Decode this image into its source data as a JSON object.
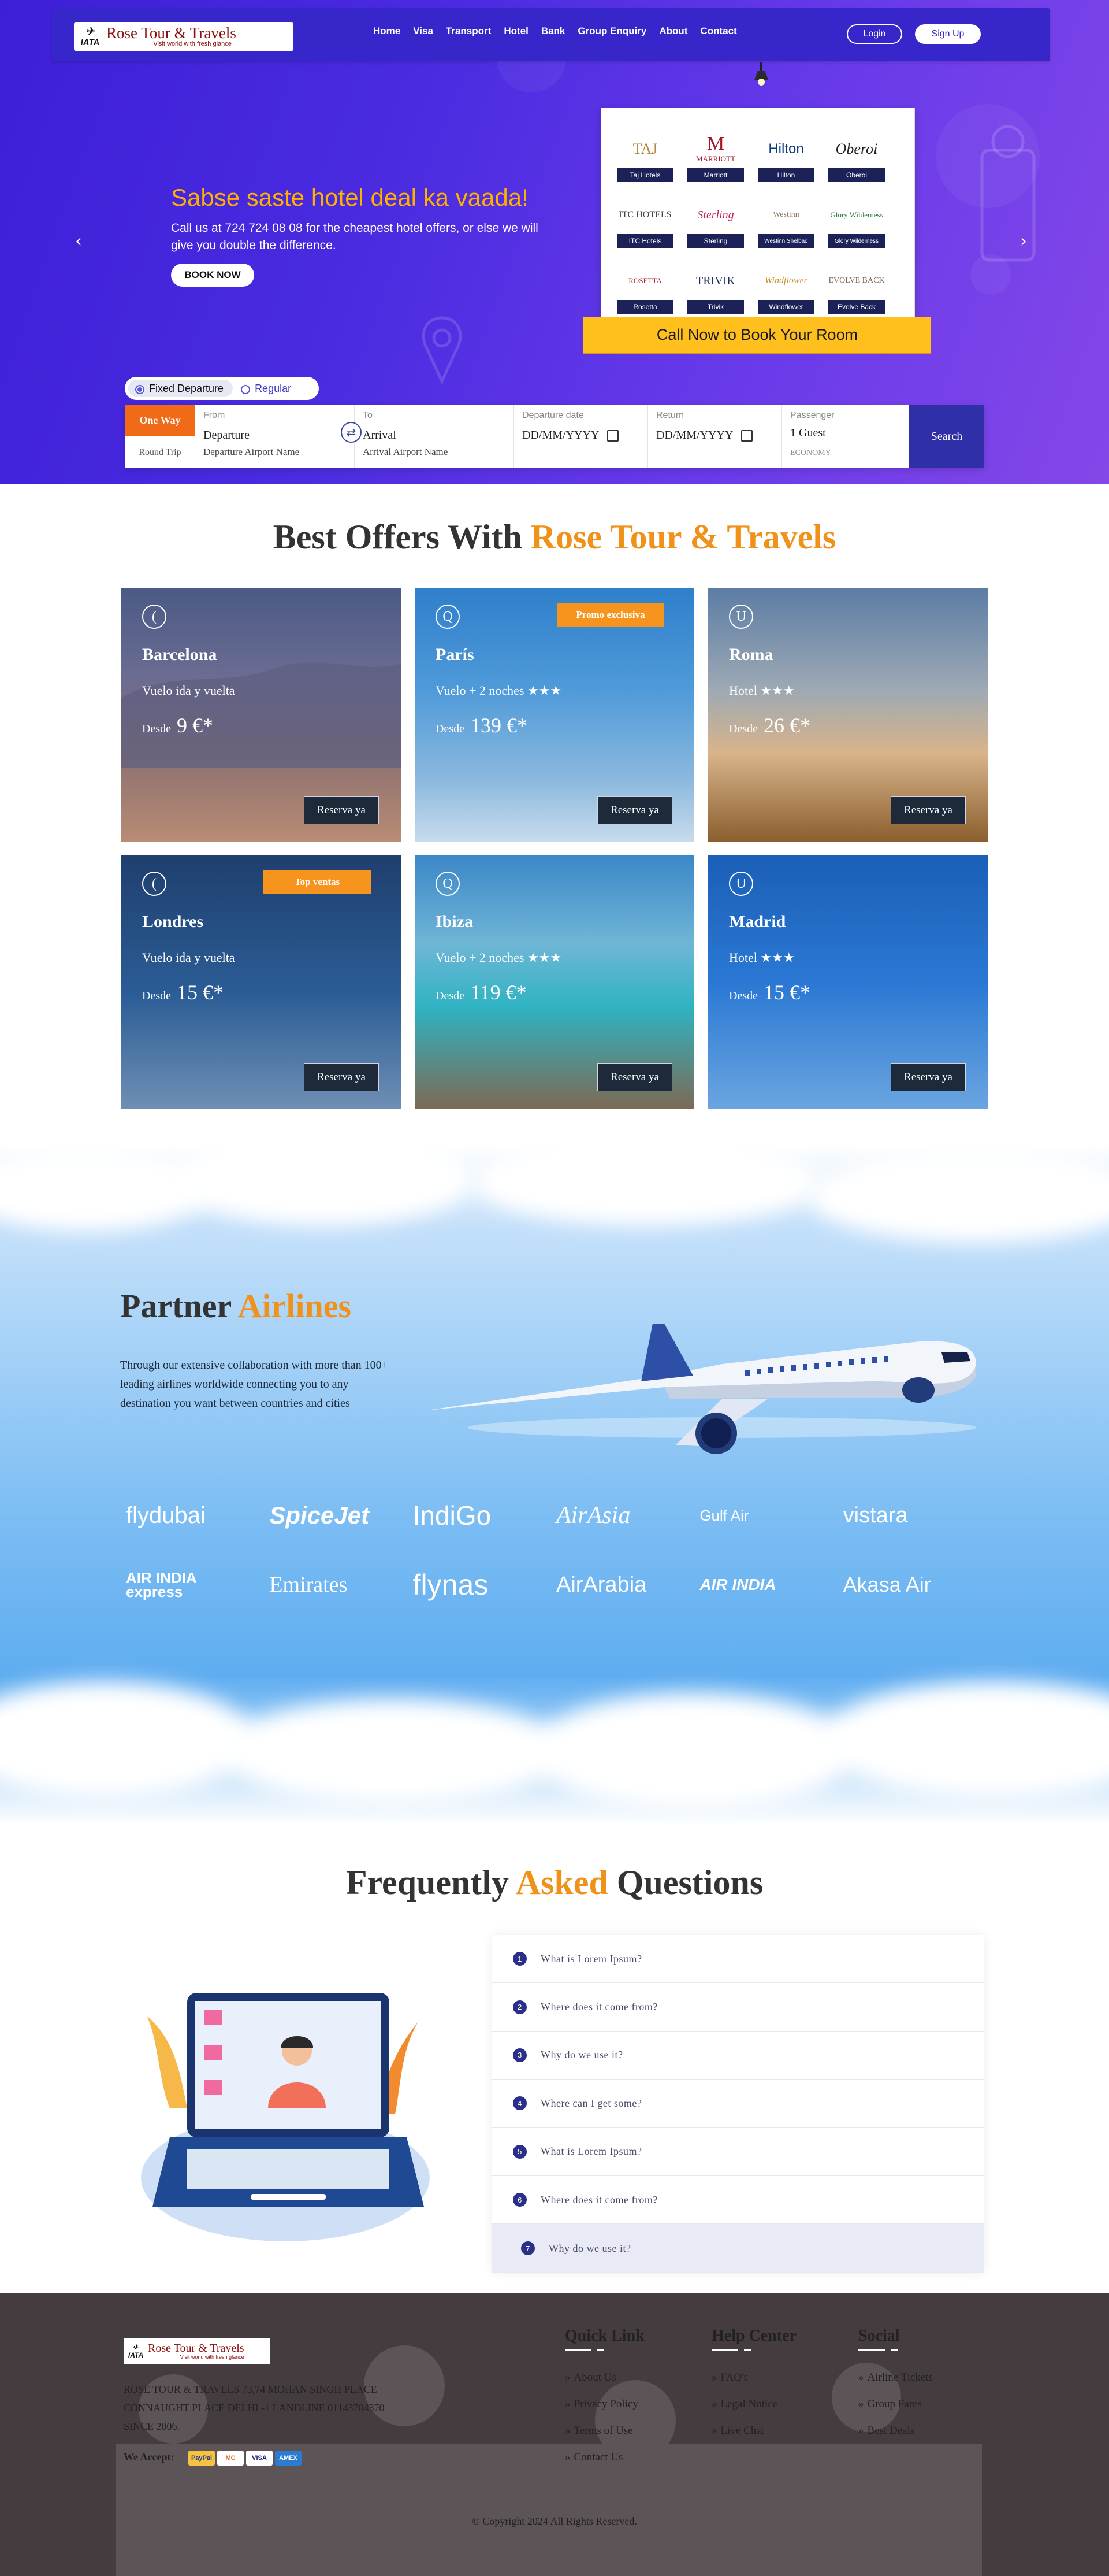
{
  "nav": {
    "brand": "Rose Tour & Travels",
    "tagline": "Visit world with fresh glance",
    "iata": "IATA",
    "menu": [
      "Home",
      "Visa",
      "Transport",
      "Hotel",
      "Bank",
      "Group Enquiry",
      "About",
      "Contact"
    ],
    "login": "Login",
    "signup": "Sign Up"
  },
  "hero": {
    "headline": "Sabse saste hotel deal ka vaada!",
    "subtext": "Call us at  724 724 08 08 for the cheapest hotel offers, or else we will give you double the difference.",
    "book_now": "BOOK NOW",
    "call_banner": "Call Now to Book Your Room",
    "hotels": [
      {
        "logo": "TAJ",
        "name": "Taj Hotels"
      },
      {
        "logo": "MARRIOTT",
        "name": "Marriott"
      },
      {
        "logo": "Hilton",
        "name": "Hilton"
      },
      {
        "logo": "Oberoi",
        "name": "Oberoi"
      },
      {
        "logo": "ITC HOTELS",
        "name": "ITC Hotels"
      },
      {
        "logo": "Sterling",
        "name": "Sterling"
      },
      {
        "logo": "Westinn",
        "name": "Westinn Shelbad"
      },
      {
        "logo": "Glory Wilderness",
        "name": "Glory Wilderness"
      },
      {
        "logo": "ROSETTA",
        "name": "Rosetta"
      },
      {
        "logo": "TRIVIK",
        "name": "Trivik"
      },
      {
        "logo": "Windflower",
        "name": "Windflower"
      },
      {
        "logo": "EVOLVE BACK",
        "name": "Evolve Back"
      }
    ]
  },
  "search": {
    "fixed": "Fixed Departure",
    "regular": "Regular",
    "one_way": "One Way",
    "round_trip": "Round Trip",
    "from_label": "From",
    "from_value": "Departure",
    "from_hint": "Departure Airport Name",
    "to_label": "To",
    "to_value": "Arrival",
    "to_hint": "Arrival Airport Name",
    "dep_label": "Departure date",
    "dep_value": "DD/MM/YYYY",
    "ret_label": "Return",
    "ret_value": "DD/MM/YYYY",
    "pax_label": "Passenger",
    "pax_value": "1 Guest",
    "pax_class": "ECONOMY",
    "button": "Search"
  },
  "offers": {
    "title_a": "Best Offers With ",
    "title_b": "Rose Tour & Travels",
    "cta": "Reserva ya",
    "desde": "Desde",
    "items": [
      {
        "icon": "(",
        "city": "Barcelona",
        "desc": "Vuelo ida y vuelta",
        "price": "9 €*",
        "promo": ""
      },
      {
        "icon": "Q",
        "city": "París",
        "desc": "Vuelo + 2 noches ★★★",
        "price": "139 €*",
        "promo": "Promo exclusiva"
      },
      {
        "icon": "U",
        "city": "Roma",
        "desc": "Hotel ★★★",
        "price": "26 €*",
        "promo": ""
      },
      {
        "icon": "(",
        "city": "Londres",
        "desc": "Vuelo ida y vuelta",
        "price": "15 €*",
        "promo": "Top ventas"
      },
      {
        "icon": "Q",
        "city": "Ibiza",
        "desc": "Vuelo + 2 noches ★★★",
        "price": "119 €*",
        "promo": ""
      },
      {
        "icon": "U",
        "city": "Madrid",
        "desc": "Hotel ★★★",
        "price": "15 €*",
        "promo": ""
      }
    ]
  },
  "partner": {
    "title_a": "Partner ",
    "title_b": "Airlines",
    "text": "Through our extensive collaboration with more than 100+ leading airlines worldwide connecting you to any destination you want between countries and cities",
    "airlines": [
      "flydubai",
      "SpiceJet",
      "IndiGo",
      "AirAsia",
      "Gulf Air",
      "vistara",
      "AIR INDIA express",
      "Emirates",
      "flynas",
      "AirArabia",
      "AIR INDIA",
      "Akasa Air"
    ]
  },
  "faq": {
    "title_a": "Frequently ",
    "title_b": "Asked",
    "title_c": " Questions",
    "items": [
      "What is Lorem Ipsum?",
      "Where does it come from?",
      "Why do we use it?",
      "Where can I get some?",
      "What is Lorem Ipsum?",
      "Where does it come from?",
      "Why do we use it?"
    ]
  },
  "footer": {
    "address": "ROSE TOUR & TRAVELS 73,74 MOHAN SINGH PLACE CONNAUGHT PLACE DELHI -1 LANDLINE 01143704370 SINCE 2006.",
    "we_accept": "We Accept:",
    "payments": [
      "PayPal",
      "MC",
      "VISA",
      "AMEX"
    ],
    "quick_title": "Quick Link",
    "quick": [
      "About Us",
      "Privacy Policy",
      "Terms of Use",
      "Contact Us"
    ],
    "help_title": "Help Center",
    "help": [
      "FAQ's",
      "Legal Notice",
      "Live Chat"
    ],
    "social_title": "Social",
    "social": [
      "Airline Tickets",
      "Group Fares",
      "Best Deals"
    ],
    "copyright": "© Copyright 2024 All Rights Reserved."
  },
  "colors": {
    "accent": "#f0921a",
    "hero": "#4a2be0",
    "nav": "#3726c9",
    "footer": "#453c3f",
    "yellow": "#ffc01e"
  }
}
